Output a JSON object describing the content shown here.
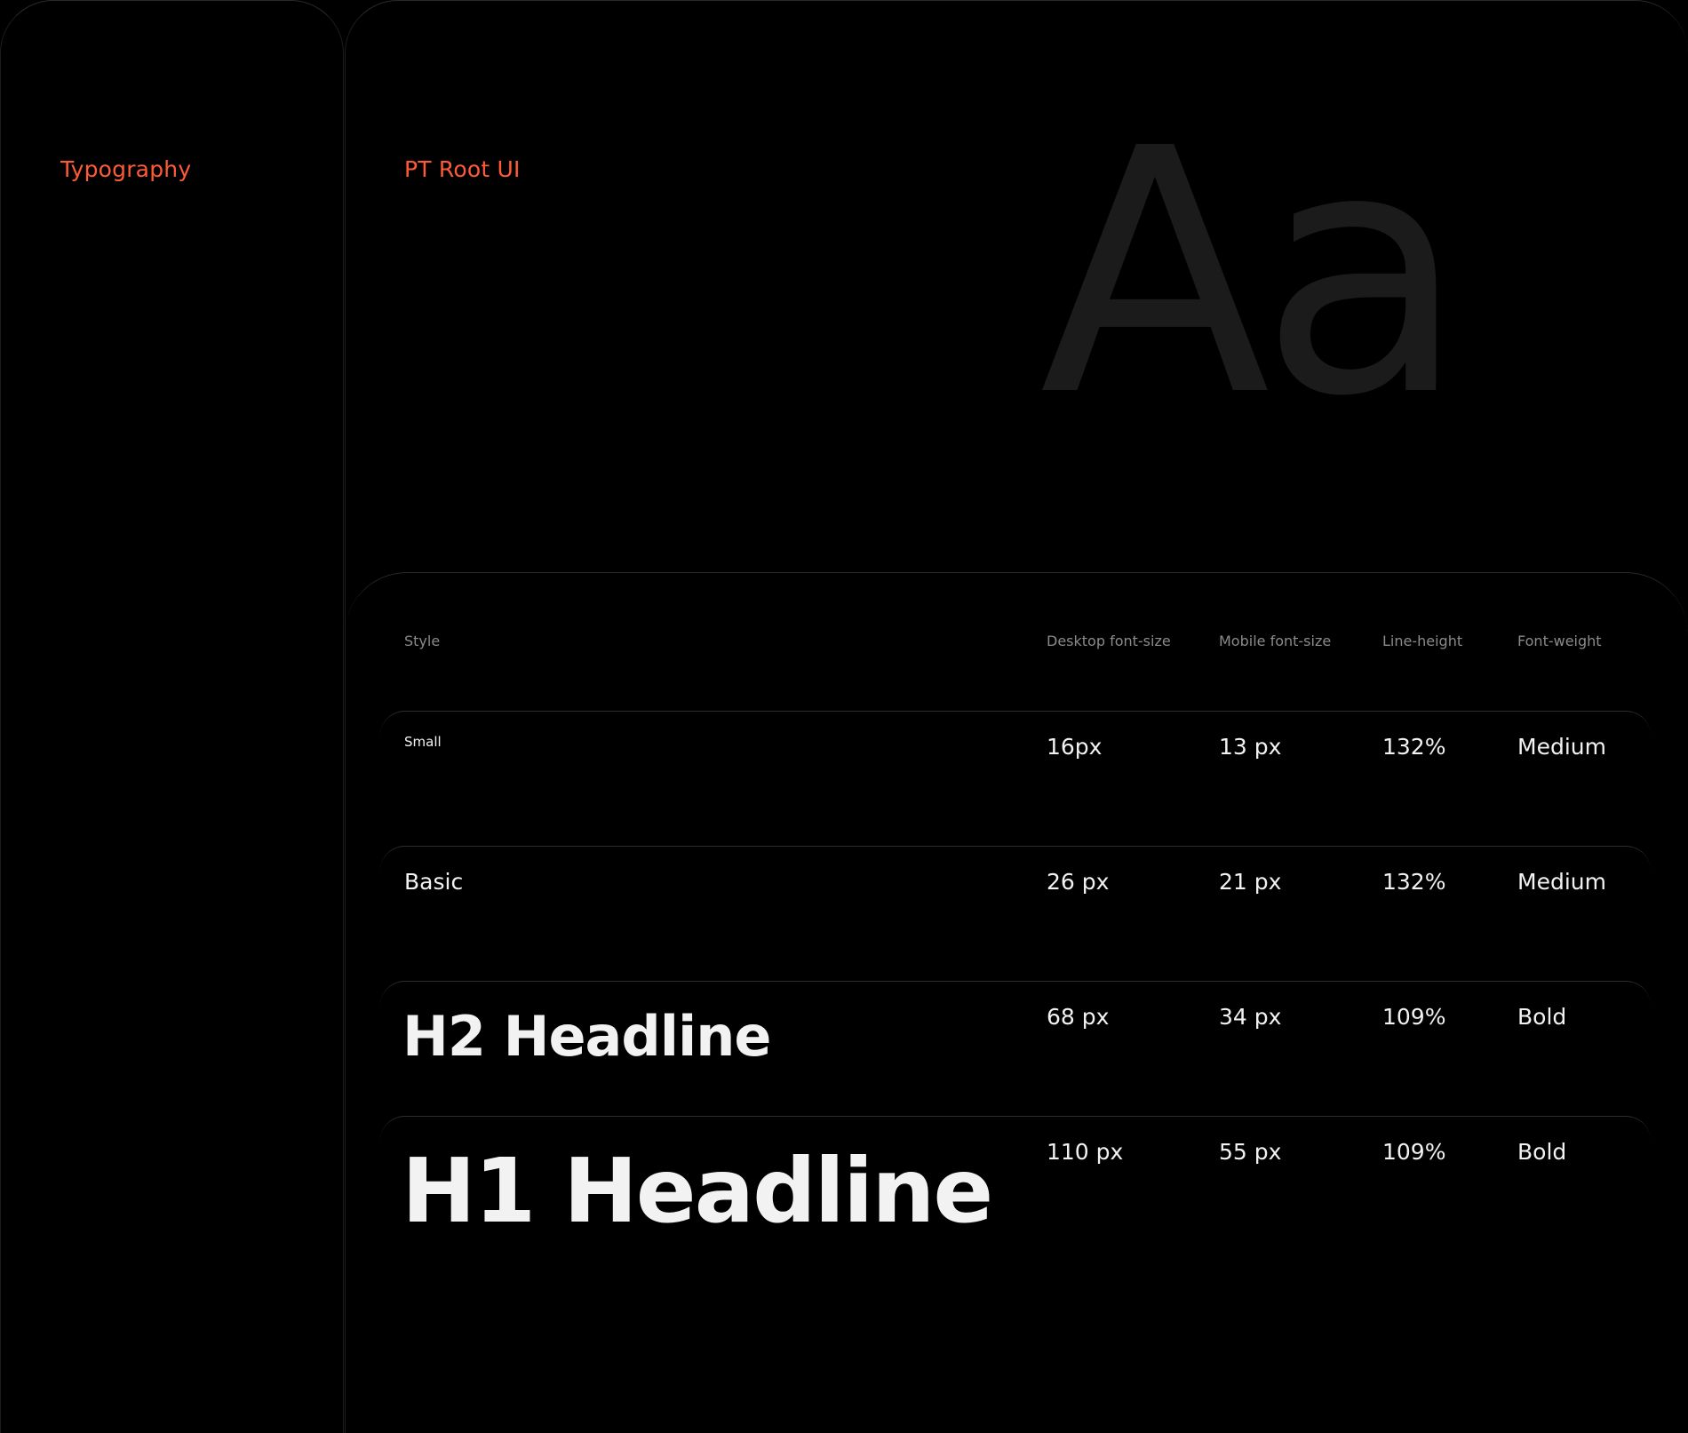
{
  "left_panel": {
    "title": "Typography"
  },
  "font_panel": {
    "font_name": "PT Root UI",
    "glyph_sample": "Aa"
  },
  "colors": {
    "accent": "#ff5a36",
    "background": "#000000",
    "glyph": "#1b1b1b",
    "header_text": "#8a8a8a"
  },
  "table": {
    "headers": [
      "Style",
      "Desktop font-size",
      "Mobile font-size",
      "Line-height",
      "Font-weight"
    ],
    "rows": [
      {
        "style": "Small",
        "desktop": "16px",
        "mobile": "13 px",
        "line_height": "132%",
        "weight": "Medium"
      },
      {
        "style": "Basic",
        "desktop": "26 px",
        "mobile": "21 px",
        "line_height": "132%",
        "weight": "Medium"
      },
      {
        "style": "H2 Headline",
        "desktop": "68 px",
        "mobile": "34 px",
        "line_height": "109%",
        "weight": "Bold"
      },
      {
        "style": "H1 Headline",
        "desktop": "110 px",
        "mobile": "55 px",
        "line_height": "109%",
        "weight": "Bold"
      }
    ]
  }
}
